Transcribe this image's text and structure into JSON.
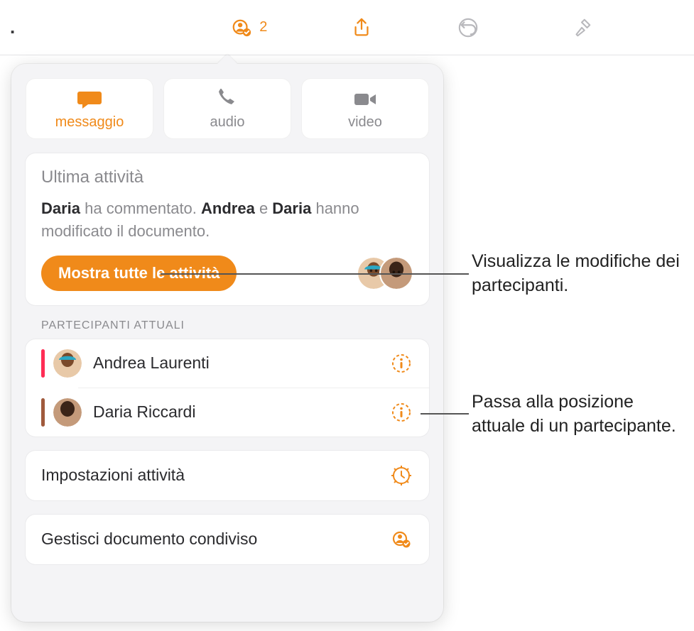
{
  "colors": {
    "accent": "#f08a1a"
  },
  "toolbar": {
    "collab_count": "2"
  },
  "modes": [
    {
      "label": "messaggio",
      "active": true
    },
    {
      "label": "audio",
      "active": false
    },
    {
      "label": "video",
      "active": false
    }
  ],
  "activity": {
    "title": "Ultima attività",
    "summary_parts": {
      "p1_bold": "Daria",
      "p2": " ha commentato. ",
      "p3_bold": "Andrea",
      "p4": " e ",
      "p5_bold": "Daria",
      "p6": " hanno modificato il documento."
    },
    "show_all_label": "Mostra tutte le attività"
  },
  "participants": {
    "header": "PARTECIPANTI ATTUALI",
    "rows": [
      {
        "name": "Andrea Laurenti",
        "color": "#ff2d55"
      },
      {
        "name": "Daria Riccardi",
        "color": "#a05a3c"
      }
    ]
  },
  "settings_row_label": "Impostazioni attività",
  "manage_row_label": "Gestisci documento condiviso",
  "callouts": {
    "c1": "Visualizza le modifiche dei partecipanti.",
    "c2": "Passa alla posizione attuale di un partecipante."
  }
}
